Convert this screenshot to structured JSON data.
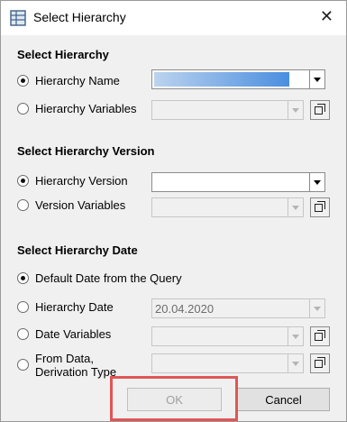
{
  "window": {
    "title": "Select Hierarchy"
  },
  "sections": {
    "hierarchy": "Select Hierarchy",
    "version": "Select Hierarchy Version",
    "date": "Select Hierarchy Date"
  },
  "options": {
    "hierarchy_name": "Hierarchy Name",
    "hierarchy_variables": "Hierarchy Variables",
    "hierarchy_version": "Hierarchy Version",
    "version_variables": "Version Variables",
    "default_date": "Default Date from the Query",
    "hierarchy_date": "Hierarchy Date",
    "date_variables": "Date Variables",
    "from_data_line1": "From Data,",
    "from_data_line2": "Derivation Type"
  },
  "fields": {
    "hierarchy_date_value": "20.04.2020"
  },
  "buttons": {
    "ok": "OK",
    "cancel": "Cancel"
  },
  "icons": {
    "app": "hierarchy-table-icon",
    "close": "close-icon",
    "dropdown": "chevron-down-icon",
    "copy": "copy-icon"
  }
}
